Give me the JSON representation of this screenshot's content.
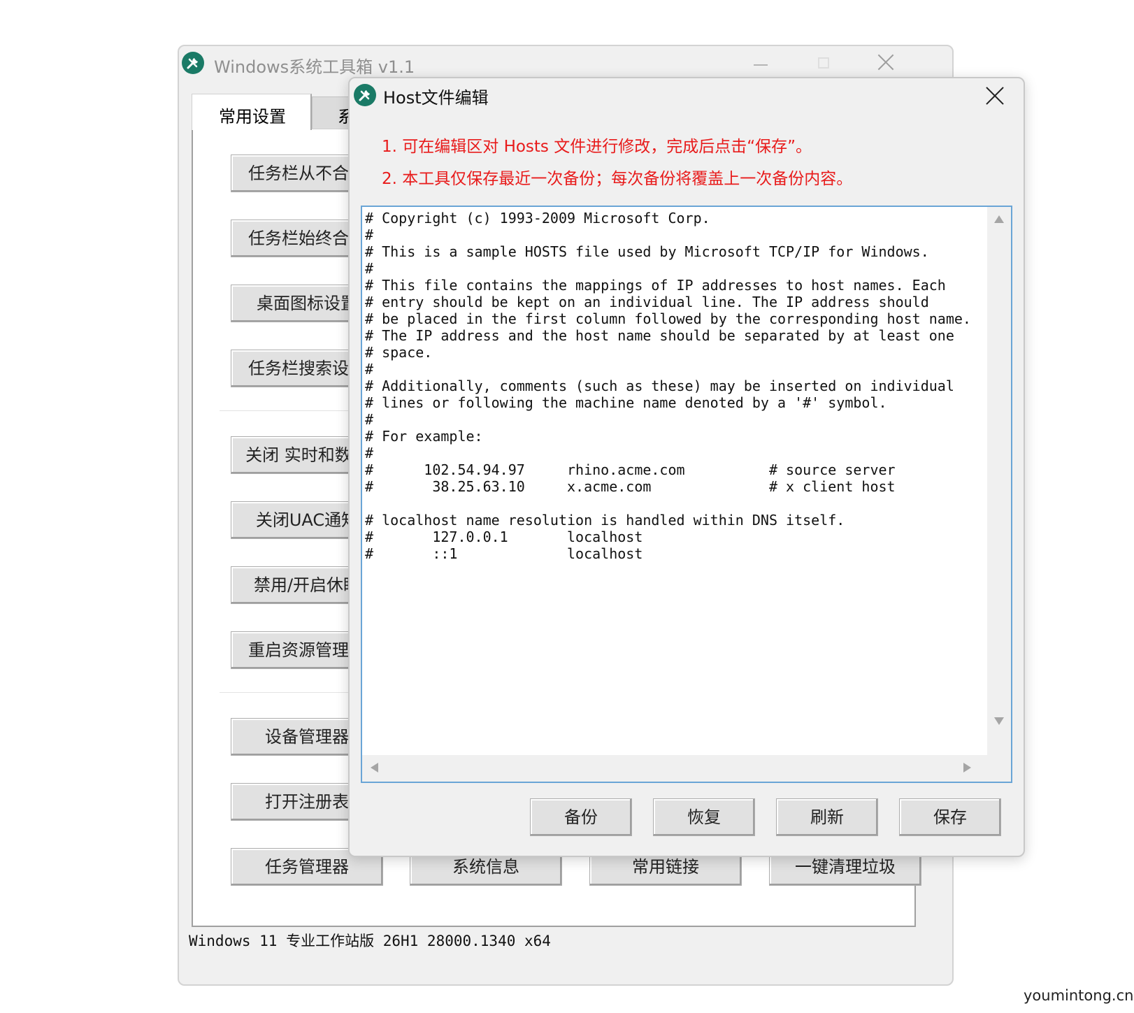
{
  "main_window": {
    "title": "Windows系统工具箱 v1.1",
    "tabs": [
      {
        "label": "常用设置",
        "active": true
      },
      {
        "label": "系",
        "active": false
      }
    ],
    "left_buttons": [
      "任务栏从不合并",
      "任务栏始终合并",
      "桌面图标设置",
      "任务栏搜索设置",
      "关闭 实时和数改",
      "关闭UAC通知",
      "禁用/开启休眠",
      "重启资源管理器",
      "设备管理器",
      "打开注册表"
    ],
    "bottom_buttons": [
      "任务管理器",
      "系统信息",
      "常用链接",
      "一键清理垃圾"
    ],
    "status": "Windows 11 专业工作站版 26H1 28000.1340 x64"
  },
  "dialog": {
    "title": "Host文件编辑",
    "notices": [
      "1. 可在编辑区对 Hosts 文件进行修改，完成后点击“保存”。",
      "2. 本工具仅保存最近一次备份；每次备份将覆盖上一次备份内容。"
    ],
    "hosts_content": "# Copyright (c) 1993-2009 Microsoft Corp.\n#\n# This is a sample HOSTS file used by Microsoft TCP/IP for Windows.\n#\n# This file contains the mappings of IP addresses to host names. Each\n# entry should be kept on an individual line. The IP address should\n# be placed in the first column followed by the corresponding host name.\n# The IP address and the host name should be separated by at least one\n# space.\n#\n# Additionally, comments (such as these) may be inserted on individual\n# lines or following the machine name denoted by a '#' symbol.\n#\n# For example:\n#\n#      102.54.94.97     rhino.acme.com          # source server\n#       38.25.63.10     x.acme.com              # x client host\n\n# localhost name resolution is handled within DNS itself.\n#       127.0.0.1       localhost\n#       ::1             localhost",
    "buttons": [
      "备份",
      "恢复",
      "刷新",
      "保存"
    ]
  },
  "watermark": "youmintong.cn",
  "colors": {
    "notice": "#e81b1b",
    "app_icon": "#1a7a66",
    "editor_border": "#6aa5d6"
  }
}
